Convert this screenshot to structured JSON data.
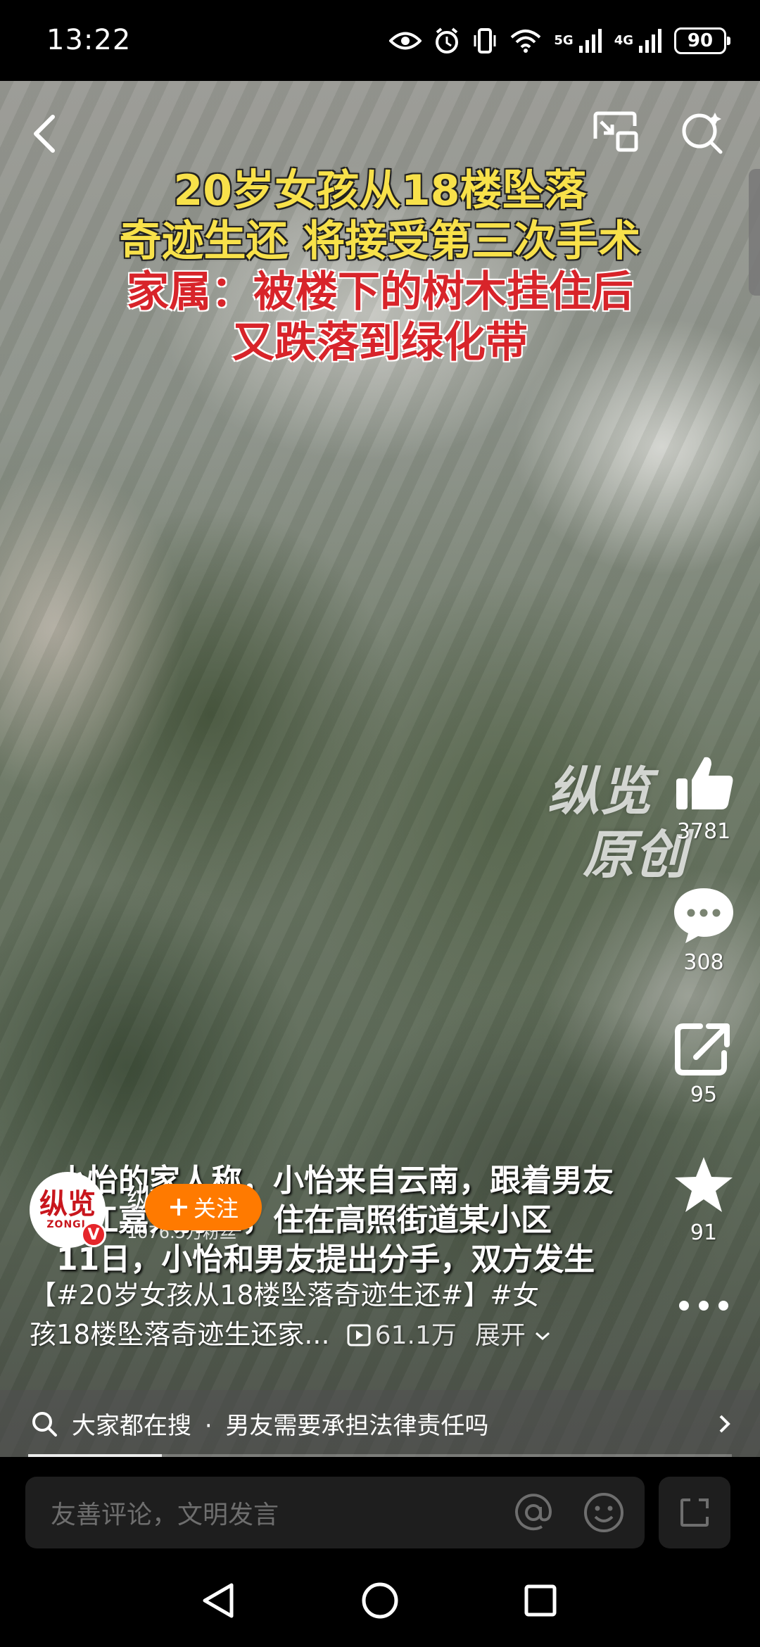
{
  "status_bar": {
    "time": "13:22",
    "network_1": "5G",
    "network_2": "4G",
    "battery": "90",
    "icons": [
      "eye-icon",
      "alarm-icon",
      "vibrate-icon",
      "wifi-icon",
      "signal-icon",
      "signal-icon",
      "battery-icon"
    ]
  },
  "video": {
    "headline_lines": [
      "20岁女孩从18楼坠落",
      "奇迹生还  将接受第三次手术",
      "家属：被楼下的树木挂住后",
      "又跌落到绿化带"
    ],
    "watermark_1": "纵览",
    "watermark_2": "原创",
    "subtitle_lines": [
      "小怡的家人称，小怡来自云南，跟着男友",
      "浙江嘉兴打工，住在高照街道某小区",
      "11日，小怡和男友提出分手，双方发生"
    ]
  },
  "actions": {
    "like_count": "3781",
    "comment_count": "308",
    "share_count": "95",
    "favorite_count": "91"
  },
  "author": {
    "avatar_text": "纵览",
    "avatar_sub": "ZONGL",
    "badge": "V",
    "name": "纵览新闻",
    "fans": "1076.5万粉丝",
    "follow_label": "关注"
  },
  "description": {
    "line1": "【#20岁女孩从18楼坠落奇迹生还#】#女",
    "line2": "孩18楼坠落奇迹生还家...",
    "plays": "61.1万",
    "expand_label": "展开"
  },
  "search_suggestion": {
    "prefix": "大家都在搜",
    "separator": "·",
    "query": "男友需要承担法律责任吗"
  },
  "playback": {
    "progress_fraction": 0.19
  },
  "comment_bar": {
    "placeholder": "友善评论，文明发言"
  },
  "colors": {
    "headline_yellow": "#f8e14a",
    "headline_red": "#d8242a",
    "follow_orange": "#ff7a00",
    "brand_red": "#c8161d"
  }
}
